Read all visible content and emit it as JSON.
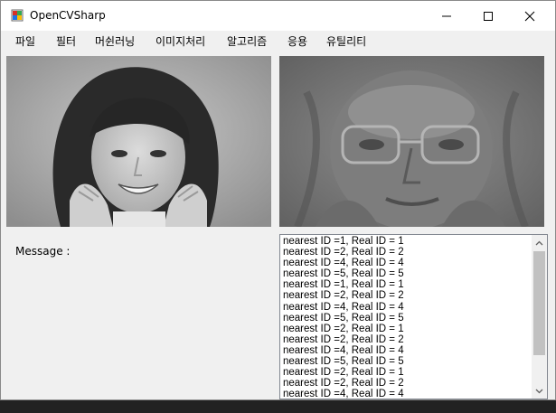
{
  "window": {
    "title": "OpenCVSharp"
  },
  "menu": [
    {
      "label": "파일"
    },
    {
      "label": "필터"
    },
    {
      "label": "머쉰러닝"
    },
    {
      "label": "이미지처리"
    },
    {
      "label": "알고리즘"
    },
    {
      "label": "응용"
    },
    {
      "label": "유틸리티"
    }
  ],
  "message": {
    "label": "Message :"
  },
  "results": [
    "nearest ID =1, Real ID = 1",
    "nearest ID =2, Real ID = 2",
    "nearest ID =4, Real ID = 4",
    "nearest ID =5, Real ID = 5",
    "nearest ID =1, Real ID = 1",
    "nearest ID =2, Real ID = 2",
    "nearest ID =4, Real ID = 4",
    "nearest ID =5, Real ID = 5",
    "nearest ID =2, Real ID = 1",
    "nearest ID =2, Real ID = 2",
    "nearest ID =4, Real ID = 4",
    "nearest ID =5, Real ID = 5",
    "nearest ID =2, Real ID = 1",
    "nearest ID =2, Real ID = 2",
    "nearest ID =4, Real ID = 4"
  ],
  "icons": {
    "app": "opencv-app-icon",
    "minimize": "minimize-icon",
    "maximize": "maximize-icon",
    "close": "close-icon",
    "scroll_up": "chevron-up-icon",
    "scroll_down": "chevron-down-icon"
  },
  "colors": {
    "window_bg": "#f0f0f0",
    "titlebar_bg": "#ffffff",
    "list_border": "#828790",
    "scroll_thumb": "#c1c1c1"
  }
}
